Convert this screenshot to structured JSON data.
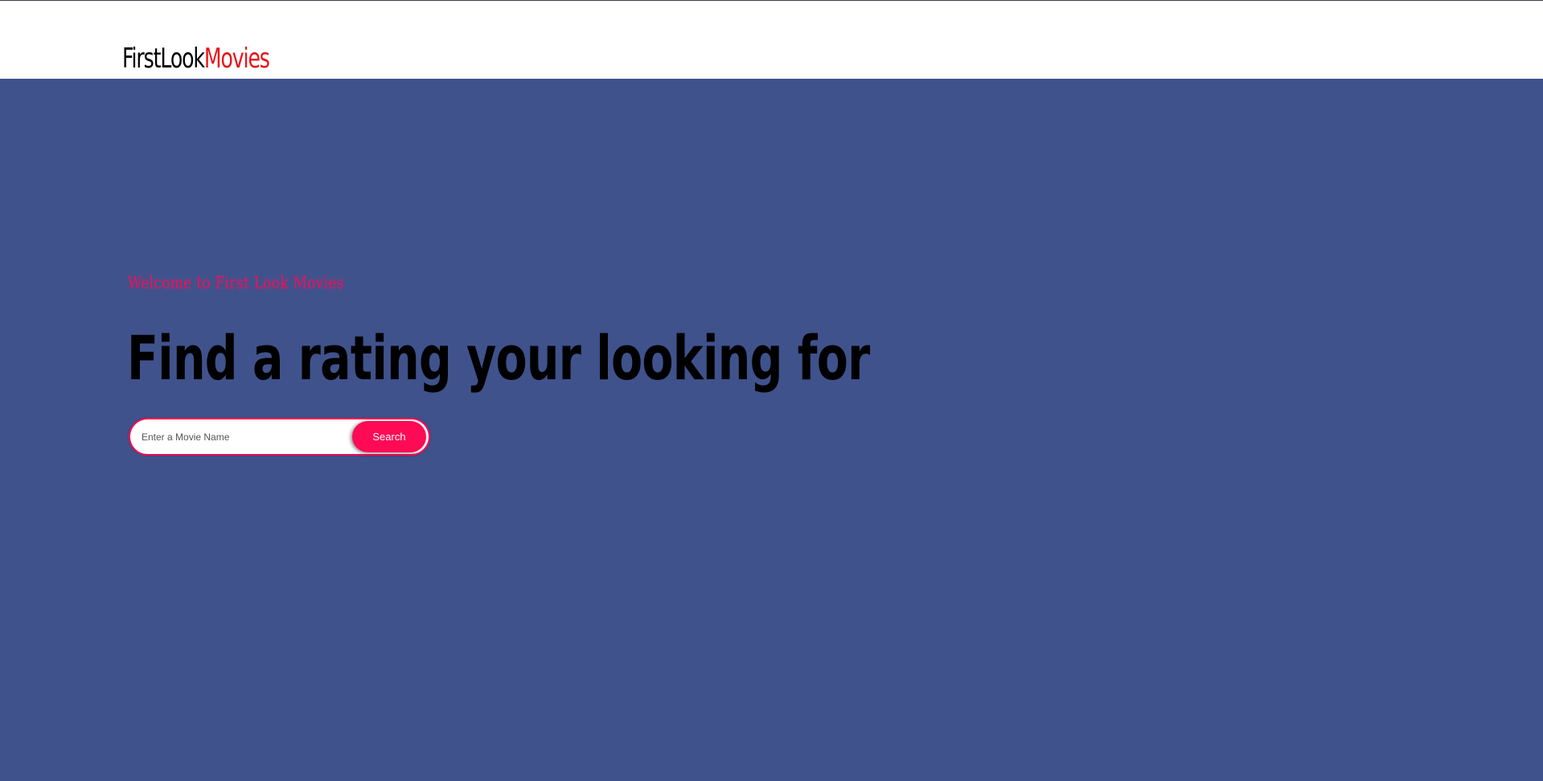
{
  "header": {
    "logo_part1": "FirstLook",
    "logo_part2": "Movies"
  },
  "hero": {
    "welcome_text": "Welcome to First Look Movies",
    "headline": "Find a rating your looking for",
    "search": {
      "placeholder": "Enter a Movie Name",
      "value": "",
      "button_label": "Search"
    }
  },
  "colors": {
    "hero_background": "#40528c",
    "accent": "#ff0a55",
    "logo_accent": "#e8141a",
    "header_background": "#ffffff"
  }
}
